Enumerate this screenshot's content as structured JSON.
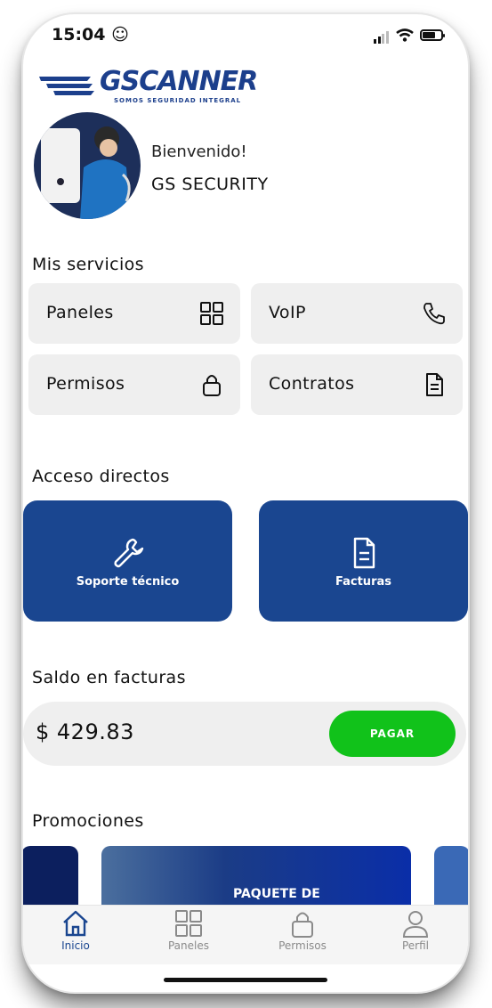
{
  "status": {
    "time": "15:04"
  },
  "brand": {
    "name": "GSCANNER",
    "tagline": "SOMOS SEGURIDAD INTEGRAL"
  },
  "user": {
    "greeting": "Bienvenido!",
    "name": "GS SECURITY"
  },
  "services": {
    "title": "Mis servicios",
    "items": [
      {
        "label": "Paneles",
        "icon": "grid-icon"
      },
      {
        "label": "VoIP",
        "icon": "phone-icon"
      },
      {
        "label": "Permisos",
        "icon": "lock-icon"
      },
      {
        "label": "Contratos",
        "icon": "document-icon"
      }
    ]
  },
  "shortcuts": {
    "title": "Acceso directos",
    "items": [
      {
        "label": "Soporte técnico",
        "icon": "wrench-icon"
      },
      {
        "label": "Facturas",
        "icon": "document-icon"
      }
    ]
  },
  "balance": {
    "title": "Saldo en facturas",
    "amount": "$ 429.83",
    "pay_label": "PAGAR"
  },
  "promotions": {
    "title": "Promociones",
    "banner_title": "PAQUETE DE"
  },
  "tabs": [
    {
      "label": "Inicio",
      "icon": "home-icon",
      "active": true
    },
    {
      "label": "Paneles",
      "icon": "grid-icon",
      "active": false
    },
    {
      "label": "Permisos",
      "icon": "lock-icon",
      "active": false
    },
    {
      "label": "Perfil",
      "icon": "user-icon",
      "active": false
    }
  ],
  "colors": {
    "primary": "#1a4690",
    "pay": "#11c21a",
    "card": "#efefef"
  }
}
